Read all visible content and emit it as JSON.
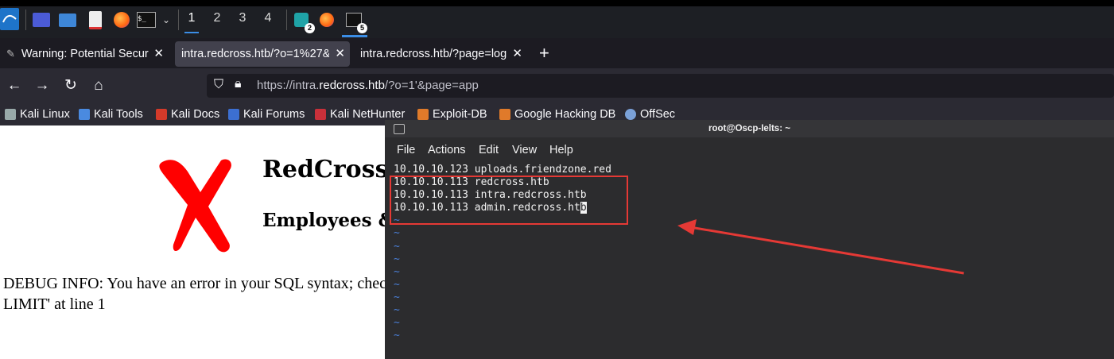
{
  "taskbar": {
    "workspaces": [
      "1",
      "2",
      "3",
      "4"
    ],
    "badges": {
      "app1": "2",
      "app2": "5"
    }
  },
  "tabs": [
    {
      "label": "Warning: Potential Security"
    },
    {
      "label": "intra.redcross.htb/?o=1%27&"
    },
    {
      "label": "intra.redcross.htb/?page=log"
    }
  ],
  "tab_close": "✕",
  "new_tab": "+",
  "url": {
    "prefix": "https://intra.",
    "domain": "redcross.htb",
    "suffix": "/?o=1'&page=app"
  },
  "bookmarks": [
    "Kali Linux",
    "Kali Tools",
    "Kali Docs",
    "Kali Forums",
    "Kali NetHunter",
    "Exploit-DB",
    "Google Hacking DB",
    "OffSec"
  ],
  "page": {
    "title": "RedCross Messaging Intranet",
    "subtitle": "Employees & providers portal",
    "debug_line1": "DEBUG INFO: You have an error in your SQL syntax; check the manual that corresponds to your MariaDB server version for the right syntax to use near",
    "debug_line2": "LIMIT' at line 1"
  },
  "terminal": {
    "title": "root@Oscp-Ielts: ~",
    "menu": [
      "File",
      "Actions",
      "Edit",
      "View",
      "Help"
    ],
    "lines": [
      "10.10.10.123 uploads.friendzone.red",
      "10.10.10.113 redcross.htb",
      "10.10.10.113 intra.redcross.htb"
    ],
    "last_line": "10.10.10.113 admin.redcross.ht",
    "cursor_char": "b",
    "tilde": "~"
  },
  "colors": {
    "annotation": "#e53935",
    "accent": "#3b8de5"
  }
}
